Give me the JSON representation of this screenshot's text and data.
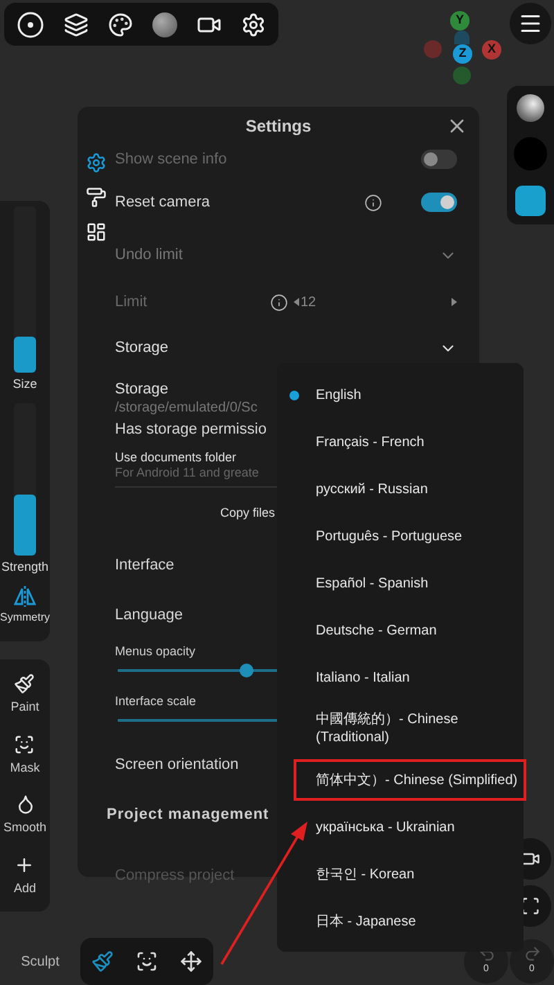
{
  "gizmo": {
    "axes": [
      {
        "label": "Y",
        "kind": "y"
      },
      {
        "label": "Z",
        "kind": "z"
      },
      {
        "label": "X",
        "kind": "x"
      }
    ]
  },
  "left_panel": {
    "sliders": [
      {
        "label": "Size",
        "level": 0.22
      },
      {
        "label": "Strength",
        "level": 0.4
      }
    ],
    "symmetry": {
      "label": "Symmetry",
      "on": true
    }
  },
  "tools": [
    {
      "label": "Paint",
      "kind": "paint"
    },
    {
      "label": "Mask",
      "kind": "mask"
    },
    {
      "label": "Smooth",
      "kind": "smooth"
    },
    {
      "label": "Add",
      "kind": "add"
    }
  ],
  "bottom_bar": {
    "mode": "Sculpt",
    "tools": [
      {
        "kind": "brush",
        "selected": true
      },
      {
        "kind": "mask",
        "selected": false
      },
      {
        "kind": "move",
        "selected": false
      }
    ]
  },
  "history": {
    "undo_count": "0",
    "redo_count": "0"
  },
  "settings": {
    "title": "Settings",
    "tabs": [
      {
        "kind": "general",
        "selected": true
      },
      {
        "kind": "paint",
        "selected": false
      },
      {
        "kind": "layout",
        "selected": false
      }
    ],
    "rows": [
      {
        "kind": "toggle",
        "label": "Show scene info",
        "on": false,
        "disabled": true
      },
      {
        "kind": "toggle",
        "label": "Reset camera",
        "on": true,
        "disabled": false,
        "info": true
      },
      {
        "kind": "section",
        "label": "Undo limit",
        "disabled": true
      },
      {
        "kind": "stepper",
        "label": "Limit",
        "value": "12",
        "disabled": true,
        "info": true
      },
      {
        "kind": "section",
        "label": "Storage",
        "disabled": false
      },
      {
        "kind": "path",
        "label": "Storage",
        "detail": "/storage/emulated/0/Sc"
      },
      {
        "kind": "text",
        "label": "Has storage permissio",
        "disabled": false
      },
      {
        "kind": "note",
        "label": "Use documents folder",
        "detail": "For Android 11 and greate"
      },
      {
        "kind": "button",
        "label": "Copy files"
      },
      {
        "kind": "group",
        "label": "Interface"
      },
      {
        "kind": "text",
        "label": "Language",
        "disabled": false
      },
      {
        "kind": "slider",
        "label": "Menus opacity",
        "level": 0.4
      },
      {
        "kind": "slider",
        "label": "Interface scale"
      },
      {
        "kind": "text",
        "label": "Screen orientation",
        "disabled": false
      },
      {
        "kind": "header",
        "label": "Project management"
      },
      {
        "kind": "text",
        "label": "Compress project",
        "disabled": true
      }
    ]
  },
  "language_menu": {
    "items": [
      {
        "label": "English",
        "selected": true,
        "annotated": false
      },
      {
        "label": "Français - French",
        "selected": false,
        "annotated": false
      },
      {
        "label": "русский - Russian",
        "selected": false,
        "annotated": false
      },
      {
        "label": "Português - Portuguese",
        "selected": false,
        "annotated": false
      },
      {
        "label": "Español - Spanish",
        "selected": false,
        "annotated": false
      },
      {
        "label": "Deutsche - German",
        "selected": false,
        "annotated": false
      },
      {
        "label": "Italiano - Italian",
        "selected": false,
        "annotated": false
      },
      {
        "label": "中國傳統的）- Chinese (Traditional)",
        "selected": false,
        "annotated": false
      },
      {
        "label": "简体中文）- Chinese (Simplified)",
        "selected": false,
        "annotated": true
      },
      {
        "label": "українська - Ukrainian",
        "selected": false,
        "annotated": false
      },
      {
        "label": "한국인 - Korean",
        "selected": false,
        "annotated": false
      },
      {
        "label": "日本 - Japanese",
        "selected": false,
        "annotated": false
      }
    ]
  }
}
